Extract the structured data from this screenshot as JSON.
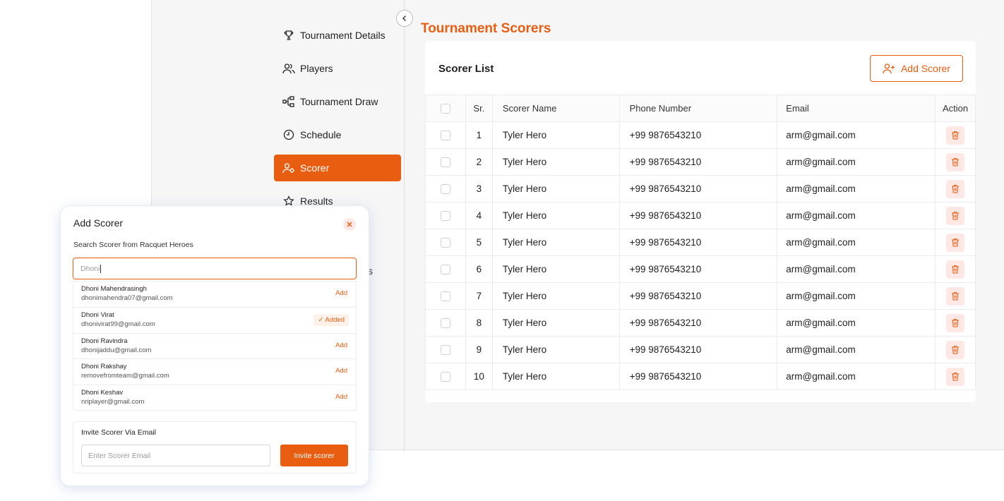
{
  "sidebar": {
    "items": [
      {
        "label": "Tournament Details",
        "icon": "trophy-icon",
        "active": false
      },
      {
        "label": "Players",
        "icon": "users-icon",
        "active": false
      },
      {
        "label": "Tournament Draw",
        "icon": "bracket-icon",
        "active": false
      },
      {
        "label": "Schedule",
        "icon": "clock-icon",
        "active": false
      },
      {
        "label": "Scorer",
        "icon": "user-gear-icon",
        "active": true
      },
      {
        "label": "Results",
        "icon": "star-icon",
        "active": false
      }
    ],
    "partial_item_suffix": "s"
  },
  "main": {
    "title": "Tournament Scorers",
    "card_title": "Scorer List",
    "add_button": "Add Scorer",
    "columns": [
      "Sr.",
      "Scorer Name",
      "Phone Number",
      "Email",
      "Action"
    ],
    "rows": [
      {
        "sr": "1",
        "name": "Tyler Hero",
        "phone": "+99 9876543210",
        "email": "arm@gmail.com"
      },
      {
        "sr": "2",
        "name": "Tyler Hero",
        "phone": "+99 9876543210",
        "email": "arm@gmail.com"
      },
      {
        "sr": "3",
        "name": "Tyler Hero",
        "phone": "+99 9876543210",
        "email": "arm@gmail.com"
      },
      {
        "sr": "4",
        "name": "Tyler Hero",
        "phone": "+99 9876543210",
        "email": "arm@gmail.com"
      },
      {
        "sr": "5",
        "name": "Tyler Hero",
        "phone": "+99 9876543210",
        "email": "arm@gmail.com"
      },
      {
        "sr": "6",
        "name": "Tyler Hero",
        "phone": "+99 9876543210",
        "email": "arm@gmail.com"
      },
      {
        "sr": "7",
        "name": "Tyler Hero",
        "phone": "+99 9876543210",
        "email": "arm@gmail.com"
      },
      {
        "sr": "8",
        "name": "Tyler Hero",
        "phone": "+99 9876543210",
        "email": "arm@gmail.com"
      },
      {
        "sr": "9",
        "name": "Tyler Hero",
        "phone": "+99 9876543210",
        "email": "arm@gmail.com"
      },
      {
        "sr": "10",
        "name": "Tyler Hero",
        "phone": "+99 9876543210",
        "email": "arm@gmail.com"
      }
    ]
  },
  "modal": {
    "title": "Add Scorer",
    "search_label": "Search Scorer from Racquet Heroes",
    "search_value": "Dhoni",
    "results": [
      {
        "name": "Dhoni Mahendrasingh",
        "email": "dhonimahendra07@gmail.com",
        "action": "Add",
        "added": false
      },
      {
        "name": "Dhoni Virat",
        "email": "dhonivirat99@gmail.com",
        "action": "✓ Added",
        "added": true
      },
      {
        "name": "Dhoni Ravindra",
        "email": "dhonijaddu@gmail.com",
        "action": "Add",
        "added": false
      },
      {
        "name": "Dhoni Rakshay",
        "email": "removefromteam@gmail.com",
        "action": "Add",
        "added": false
      },
      {
        "name": "Dhoni Keshav",
        "email": "nriplayer@gmail.com",
        "action": "Add",
        "added": false
      }
    ],
    "invite_title": "Invite Scorer Via Email",
    "invite_placeholder": "Enter Scorer Email",
    "invite_button": "Invite scorer"
  },
  "colors": {
    "accent": "#e85d10",
    "delete_bg": "#fde8e6",
    "panel_bg": "#f6f6f7"
  }
}
